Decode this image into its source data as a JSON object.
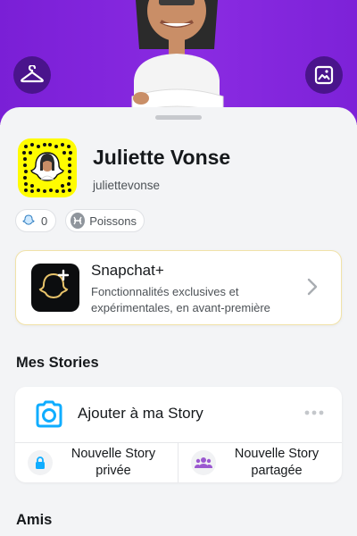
{
  "profile": {
    "display_name": "Juliette Vonse",
    "username": "juliettevonse"
  },
  "chips": {
    "friends_count": "0",
    "zodiac": "Poissons"
  },
  "snapchat_plus": {
    "title": "Snapchat+",
    "description": "Fonctionnalités exclusives et expérimentales, en avant-première"
  },
  "stories": {
    "section_title": "Mes Stories",
    "add_label": "Ajouter à ma Story",
    "private_story_label": "Nouvelle Story privée",
    "shared_story_label": "Nouvelle Story partagée"
  },
  "friends": {
    "section_title": "Amis"
  },
  "icons": {
    "hero_left": "hanger-icon",
    "hero_right": "photo-frame-icon",
    "camera": "camera-circle-icon",
    "more": "more-dots-icon",
    "lock": "lock-icon",
    "group": "group-icon",
    "chevron": "chevron-right-icon"
  },
  "colors": {
    "hero_purple": "#8a2be2",
    "snap_yellow": "#fffc00",
    "accent_blue": "#0fadff",
    "shared_purple": "#9b59d0"
  }
}
